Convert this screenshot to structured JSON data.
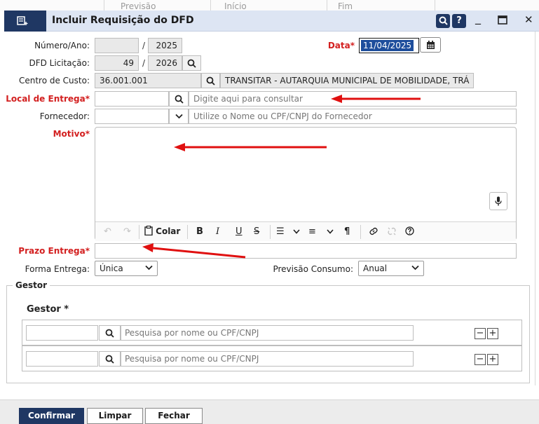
{
  "background": {
    "col1": "Previsão",
    "col2": "Início",
    "col3": "Fim"
  },
  "window": {
    "title": "Incluir Requisição do DFD",
    "search_label": "Q",
    "help_label": "?",
    "minimize_glyph": "_",
    "maximize_glyph": "■",
    "close_glyph": "✕",
    "accent_color": "#1f3763"
  },
  "form": {
    "numero_ano": {
      "label": "Número/Ano:",
      "numero": "",
      "ano": "2025"
    },
    "data": {
      "label": "Data*",
      "value": "11/04/2025"
    },
    "dfd_licitacao": {
      "label": "DFD Licitação:",
      "numero": "49",
      "ano": "2026"
    },
    "centro_custo": {
      "label": "Centro de Custo:",
      "code": "36.001.001",
      "description": "TRANSITAR - AUTARQUIA MUNICIPAL DE MOBILIDADE, TRÁ"
    },
    "local_entrega": {
      "label": "Local de Entrega*",
      "code": "",
      "placeholder": "Digite aqui para consultar"
    },
    "fornecedor": {
      "label": "Fornecedor:",
      "code": "",
      "placeholder": "Utilize o Nome ou CPF/CNPJ do Fornecedor"
    },
    "motivo": {
      "label": "Motivo*",
      "value": ""
    },
    "editor_toolbar": {
      "paste_label": "Colar"
    },
    "prazo_entrega": {
      "label": "Prazo Entrega*",
      "value": ""
    },
    "forma_entrega": {
      "label": "Forma Entrega:",
      "value": "Única"
    },
    "previsao_consumo": {
      "label": "Previsão Consumo:",
      "value": "Anual"
    },
    "separator": "/"
  },
  "gestor": {
    "section_label": "Gestor",
    "title": "Gestor *",
    "rows": [
      {
        "code": "",
        "placeholder": "Pesquisa por nome ou CPF/CNPJ"
      },
      {
        "code": "",
        "placeholder": "Pesquisa por nome ou CPF/CNPJ"
      }
    ],
    "minus_glyph": "−",
    "plus_glyph": "+"
  },
  "footer": {
    "confirm_label": "Confirmar",
    "clear_label": "Limpar",
    "close_label": "Fechar"
  },
  "colors": {
    "required": "#d32020",
    "annotation_arrow": "#e01010"
  }
}
